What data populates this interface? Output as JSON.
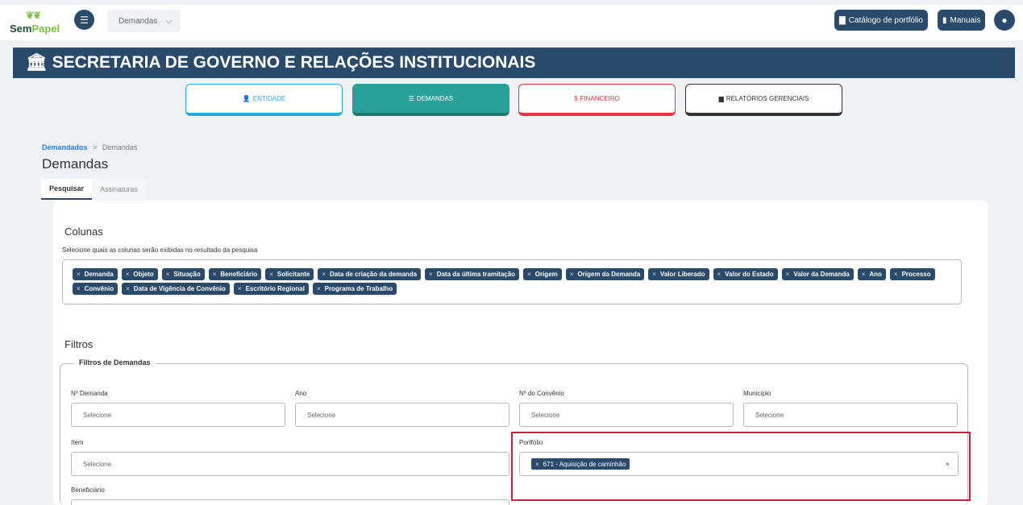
{
  "app": {
    "logo_text_1": "Sem",
    "logo_text_2": "Papel",
    "module_select": "Demandas",
    "catalog_button": "Catálogo de portfólio",
    "manuals_button": "Manuais"
  },
  "org": {
    "title": "SECRETARIA DE GOVERNO E RELAÇÕES INSTITUCIONAIS"
  },
  "nav": {
    "entidade": "ENTIDADE",
    "demandas": "DEMANDAS",
    "financeiro": "FINANCEIRO",
    "relatorios": "RELATÓRIOS GERENCIAIS"
  },
  "breadcrumb": {
    "root": "Demandados",
    "sep": ">",
    "current": "Demandas"
  },
  "page": {
    "title": "Demandas"
  },
  "tabs": {
    "active": "Pesquisar",
    "inactive": "Assinaturas"
  },
  "columns": {
    "title": "Colunas",
    "hint": "Selecione quais as colunas serão exibidas no resultado da pesquisa",
    "chip_remove": "×",
    "chips": [
      "Demanda",
      "Objeto",
      "Situação",
      "Beneficiário",
      "Solicitante",
      "Data de criação da demanda",
      "Data da última tramitação",
      "Origem",
      "Origem da Demanda",
      "Valor Liberado",
      "Valor do Estado",
      "Valor da Demanda",
      "Ano",
      "Processo",
      "Convênio",
      "Data de Vigência de Convênio",
      "Escritório Regional",
      "Programa de Trabalho"
    ]
  },
  "filters": {
    "title": "Filtros",
    "legend": "Filtros de Demandas",
    "placeholder": "Selecione",
    "demanda_label": "Nº Demanda",
    "ano_label": "Ano",
    "convenio_label": "Nº do Convênio",
    "municipio_label": "Município",
    "item_label": "Item",
    "portfolio_label": "Portfólio",
    "portfolio_selected": "671 - Aquisição de caminhão",
    "beneficiario_label": "Beneficiário"
  }
}
